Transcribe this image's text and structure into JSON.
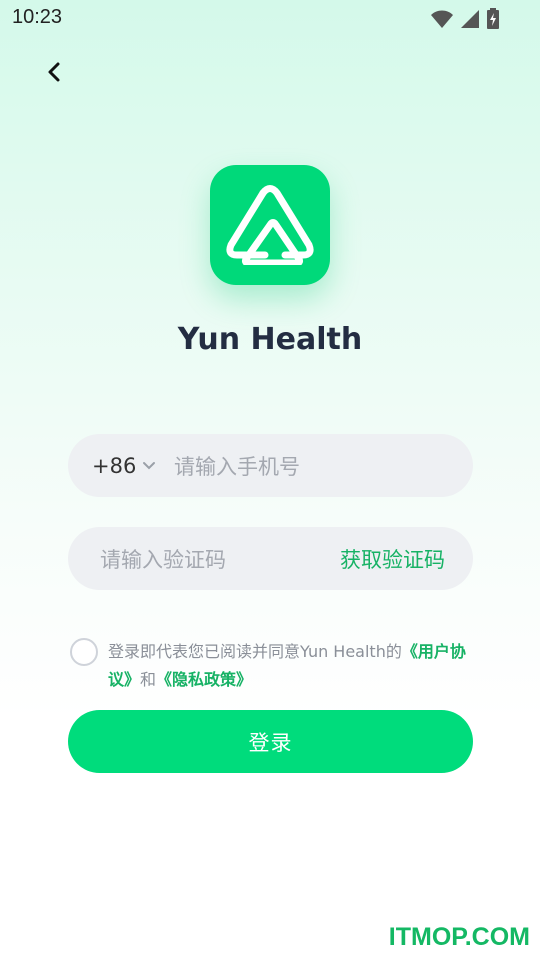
{
  "status_bar": {
    "time": "10:23",
    "icons": [
      "wifi-icon",
      "signal-icon",
      "battery-charging-icon"
    ]
  },
  "nav": {
    "back_icon": "chevron-left-icon"
  },
  "brand": {
    "logo_icon": "triangle-logo-icon",
    "app_name": "Yun Health",
    "accent_color": "#00dc7c",
    "link_color": "#17b265"
  },
  "phone_field": {
    "country_code": "+86",
    "dropdown_icon": "chevron-down-icon",
    "placeholder": "请输入手机号",
    "value": ""
  },
  "code_field": {
    "placeholder": "请输入验证码",
    "value": "",
    "get_code_label": "获取验证码"
  },
  "agreement": {
    "checked": false,
    "prefix": "登录即代表您已阅读并同意Yun Health的",
    "user_agreement": "《用户协议》",
    "conjunction": "和",
    "privacy_policy": "《隐私政策》"
  },
  "login_button": {
    "label": "登录"
  },
  "watermark": {
    "text": "ITMOP.COM"
  }
}
